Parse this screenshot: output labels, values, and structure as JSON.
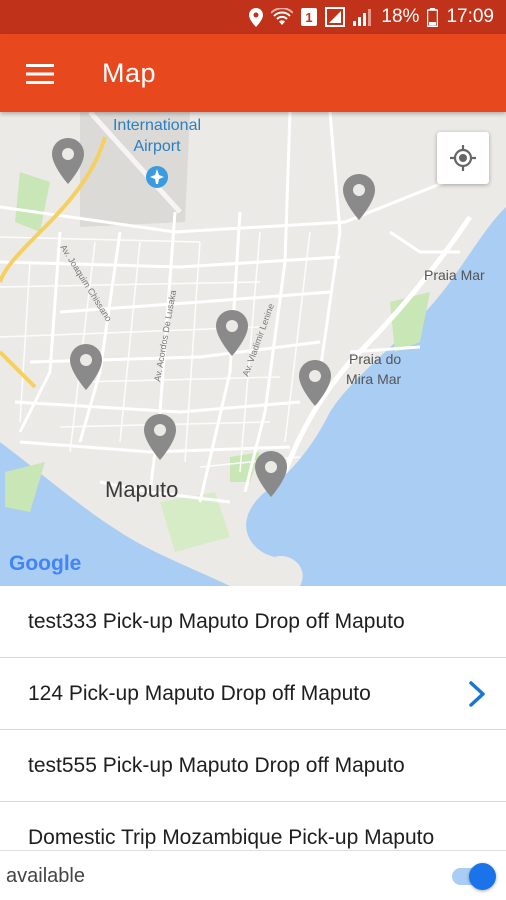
{
  "status_bar": {
    "battery": "18%",
    "time": "17:09",
    "sim_badge": "1",
    "icons": [
      "location-icon",
      "wifi-icon",
      "sim-icon",
      "lte-icon",
      "signal-icon",
      "battery-icon"
    ]
  },
  "app_bar": {
    "title": "Map",
    "menu_icon": "hamburger-menu-icon",
    "color": "#e8481e",
    "status_color": "#c0321a"
  },
  "map": {
    "labels": {
      "airport": "International",
      "airport2": "Airport",
      "city": "Maputo",
      "praia_mar": "Praia Mar",
      "praia_do": "Praia do",
      "mira_mar": "Mira Mar",
      "street1": "Av. Joaquim Chissano",
      "street2": "Av. Acordos De Lusaka",
      "street3": "Av. Vladimir Lenine",
      "google": "Google"
    },
    "marker_count": 7,
    "water_color": "#a9cdf3",
    "land_color": "#eceae6",
    "park_color": "#c9e6b6",
    "marker_color": "#888888",
    "locate_icon": "my-location-icon"
  },
  "trips": [
    {
      "label": "test333 Pick-up Maputo Drop off Maputo",
      "selected": false
    },
    {
      "label": "124 Pick-up Maputo Drop off Maputo",
      "selected": true
    },
    {
      "label": "test555 Pick-up Maputo Drop off Maputo",
      "selected": false
    },
    {
      "label": "Domestic Trip Mozambique Pick-up Maputo",
      "selected": false
    }
  ],
  "availability": {
    "label": "available",
    "enabled": true,
    "accent": "#1a73e8"
  }
}
